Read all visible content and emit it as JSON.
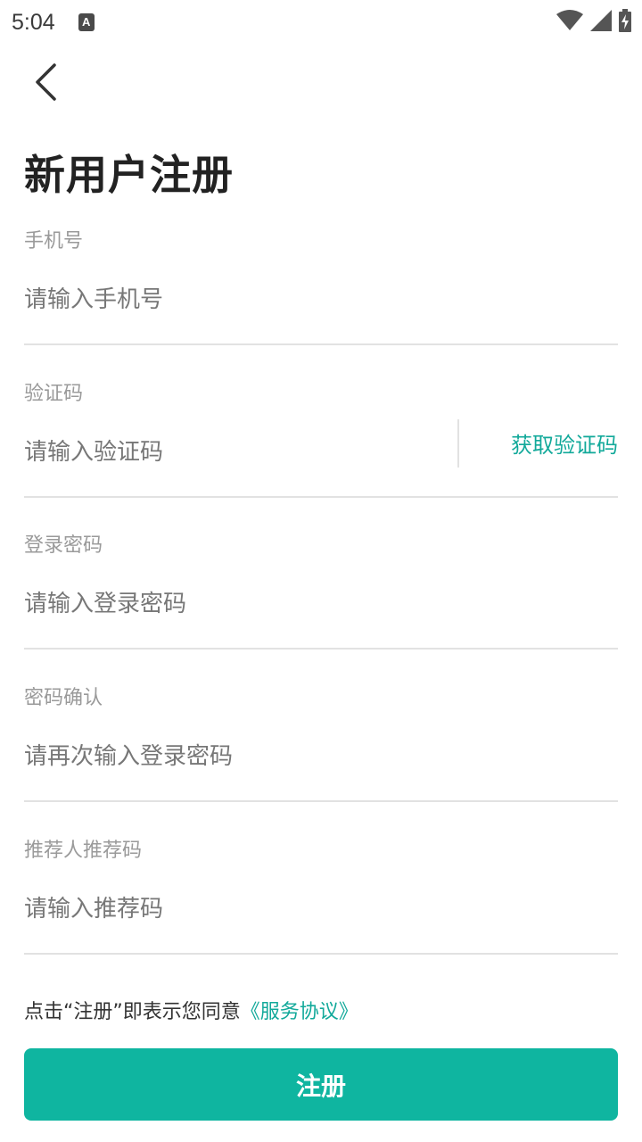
{
  "status_bar": {
    "time": "5:04",
    "notification_icon_letter": "A"
  },
  "header": {
    "title": "新用户注册"
  },
  "form": {
    "phone": {
      "label": "手机号",
      "placeholder": "请输入手机号"
    },
    "code": {
      "label": "验证码",
      "placeholder": "请输入验证码",
      "get_code_label": "获取验证码"
    },
    "password": {
      "label": "登录密码",
      "placeholder": "请输入登录密码"
    },
    "confirm_password": {
      "label": "密码确认",
      "placeholder": "请再次输入登录密码"
    },
    "referral": {
      "label": "推荐人推荐码",
      "placeholder": "请输入推荐码"
    }
  },
  "agreement": {
    "prefix": "点击“注册”即表示您同意",
    "link": "《服务协议》"
  },
  "submit": {
    "label": "注册"
  },
  "colors": {
    "accent": "#12a99a",
    "button": "#0fb5a0"
  },
  "icons": [
    "back-arrow-icon",
    "wifi-icon",
    "signal-icon",
    "battery-charging-icon",
    "notification-a-icon"
  ]
}
